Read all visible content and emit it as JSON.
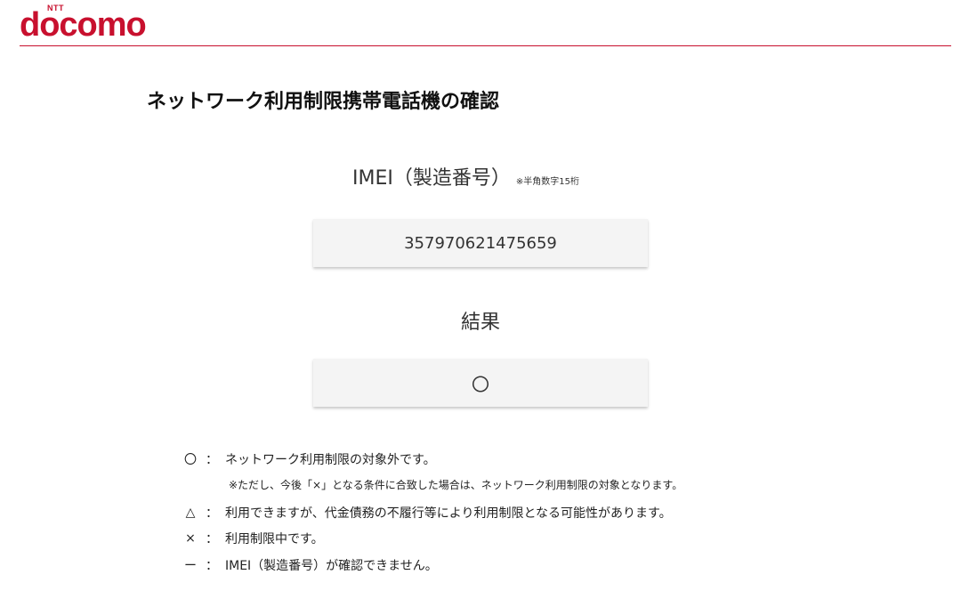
{
  "header": {
    "logo_small": "NTT",
    "logo_main": "docomo",
    "brand_color": "#c8102e"
  },
  "page": {
    "title": "ネットワーク利用制限携帯電話機の確認"
  },
  "imei": {
    "label": "IMEI（製造番号）",
    "note": "※半角数字15桁",
    "value": "357970621475659"
  },
  "result": {
    "label": "結果",
    "value": "〇"
  },
  "legend": {
    "items": [
      {
        "symbol": "〇",
        "colon": "：",
        "text": "ネットワーク利用制限の対象外です。"
      },
      {
        "symbol": "△",
        "colon": "：",
        "text": "利用できますが、代金債務の不履行等により利用制限となる可能性があります。"
      },
      {
        "symbol": "×",
        "colon": "：",
        "text": "利用制限中です。"
      },
      {
        "symbol": "ー",
        "colon": "：",
        "text": "IMEI（製造番号）が確認できません。"
      }
    ],
    "note": "※ただし、今後「×」となる条件に合致した場合は、ネットワーク利用制限の対象となります。"
  }
}
